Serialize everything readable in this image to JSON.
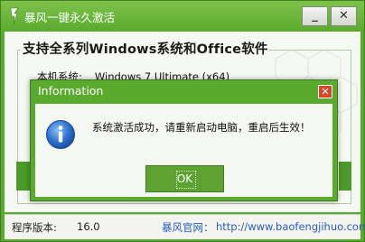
{
  "window": {
    "title": "暴风一键永久激活",
    "minimize_label": "_",
    "close_label": "✕",
    "icon": "app-lightning-icon"
  },
  "main": {
    "headline": "支持全系列Windows系统和Office软件",
    "system_label": "本机系统:",
    "system_value": "Windows 7 Ultimate (x64)"
  },
  "statusbar": {
    "version_label": "程序版本:",
    "version_value": "16.0",
    "site_label": "暴风官网：",
    "site_url": "http://www.baofengjihuo.com"
  },
  "dialog": {
    "title": "Information",
    "close_icon": "close-icon",
    "icon": "info-icon",
    "message": "系统激活成功，请重新启动电脑，重启后生效！",
    "ok_label": "OK"
  },
  "colors": {
    "titlebar_green": "#5aaa2e",
    "dialog_close_red": "#d9462c",
    "link_blue": "#2a5db8"
  }
}
